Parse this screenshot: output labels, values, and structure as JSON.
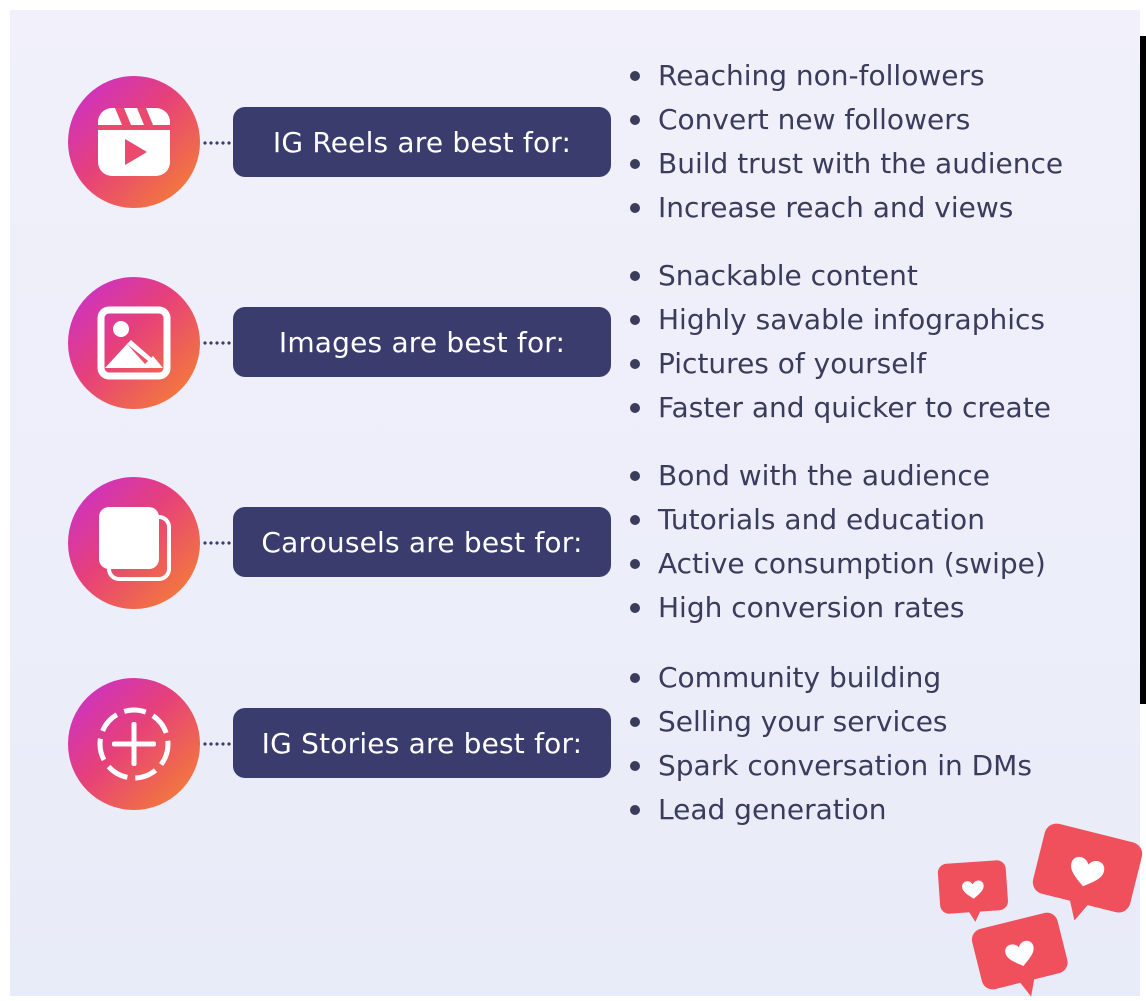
{
  "sections": [
    {
      "icon": "reels-icon",
      "label": "IG Reels are best for:",
      "bullets": [
        "Reaching non-followers",
        "Convert new followers",
        "Build trust with the audience",
        "Increase reach and views"
      ]
    },
    {
      "icon": "image-icon",
      "label": "Images are best for:",
      "bullets": [
        "Snackable content",
        "Highly savable infographics",
        "Pictures of yourself",
        "Faster and quicker to create"
      ]
    },
    {
      "icon": "carousel-icon",
      "label": "Carousels are best for:",
      "bullets": [
        "Bond with the audience",
        "Tutorials and education",
        "Active consumption (swipe)",
        "High conversion rates"
      ]
    },
    {
      "icon": "stories-add-icon",
      "label": "IG Stories are best for:",
      "bullets": [
        "Community building",
        "Selling your services",
        "Spark conversation in DMs",
        "Lead generation"
      ]
    }
  ],
  "colors": {
    "pill": "#3a3c6e",
    "text": "#3a3c5c",
    "gradient_start": "#c52fd6",
    "gradient_mid": "#e6407a",
    "gradient_end": "#f6882b",
    "heart_bubble": "#f0505c"
  },
  "decoration": {
    "icon": "heart-notification-icon"
  }
}
